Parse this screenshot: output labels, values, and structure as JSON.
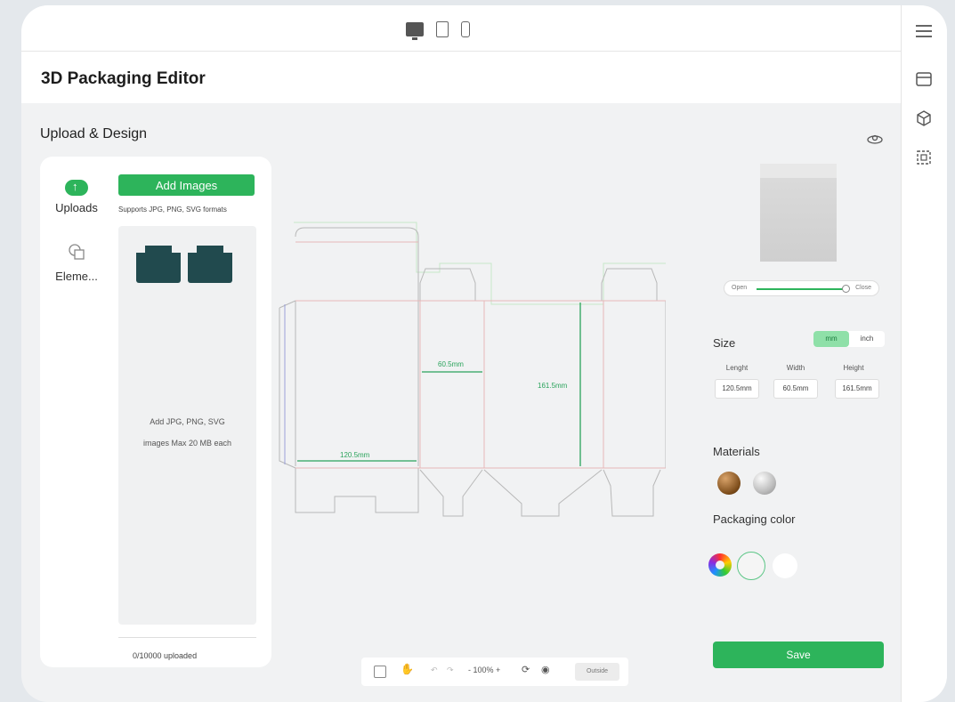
{
  "header": {
    "device_icons": [
      "desktop-icon",
      "tablet-icon",
      "phone-icon"
    ],
    "app_title": "3D Packaging Editor"
  },
  "right_rail": {
    "icons": [
      "hamburger-menu-icon",
      "store-icon",
      "cube-icon",
      "frame-icon"
    ]
  },
  "main": {
    "section_title": "Upload & Design",
    "view_3d_icon": "3d-view-icon"
  },
  "left_panel": {
    "tabs": [
      {
        "label": "Uploads",
        "icon": "cloud-upload-icon"
      },
      {
        "label": "Eleme...",
        "icon": "shapes-icon"
      }
    ],
    "add_images_label": "Add Images",
    "support_text": "Supports JPG, PNG, SVG formats",
    "drop_hint_line1": "Add JPG, PNG, SVG",
    "drop_hint_line2": "images Max 20 MB each",
    "uploaded_count": "0/10000 uploaded"
  },
  "dieline": {
    "width_label": "60.5mm",
    "height_label": "161.5mm",
    "length_label": "120.5mm",
    "colors": {
      "cut": "#e8b8b8",
      "fold": "#d9b6c7",
      "bleed": "#c8e8c8",
      "dimension": "#2aa35b",
      "glue": "#9aa0d8"
    }
  },
  "preview": {
    "open_label": "Open",
    "close_label": "Close",
    "open_level": 1.0
  },
  "size": {
    "label": "Size",
    "units": [
      "mm",
      "inch"
    ],
    "active_unit": "mm",
    "dims": [
      {
        "label": "Lenght",
        "value": "120.5mm"
      },
      {
        "label": "Width",
        "value": "60.5mm"
      },
      {
        "label": "Height",
        "value": "161.5mm"
      }
    ]
  },
  "materials": {
    "label": "Materials",
    "items": [
      "wood-material",
      "silver-material"
    ]
  },
  "packaging_color": {
    "label": "Packaging color",
    "swatches": [
      "color-wheel",
      "#f5f5f5",
      "#ffffff"
    ]
  },
  "save_label": "Save",
  "toolbar": {
    "undo": "↶",
    "redo": "↷",
    "zoom": "- 100% +",
    "outside_label": "Outside"
  },
  "accent_color": "#2db45b"
}
